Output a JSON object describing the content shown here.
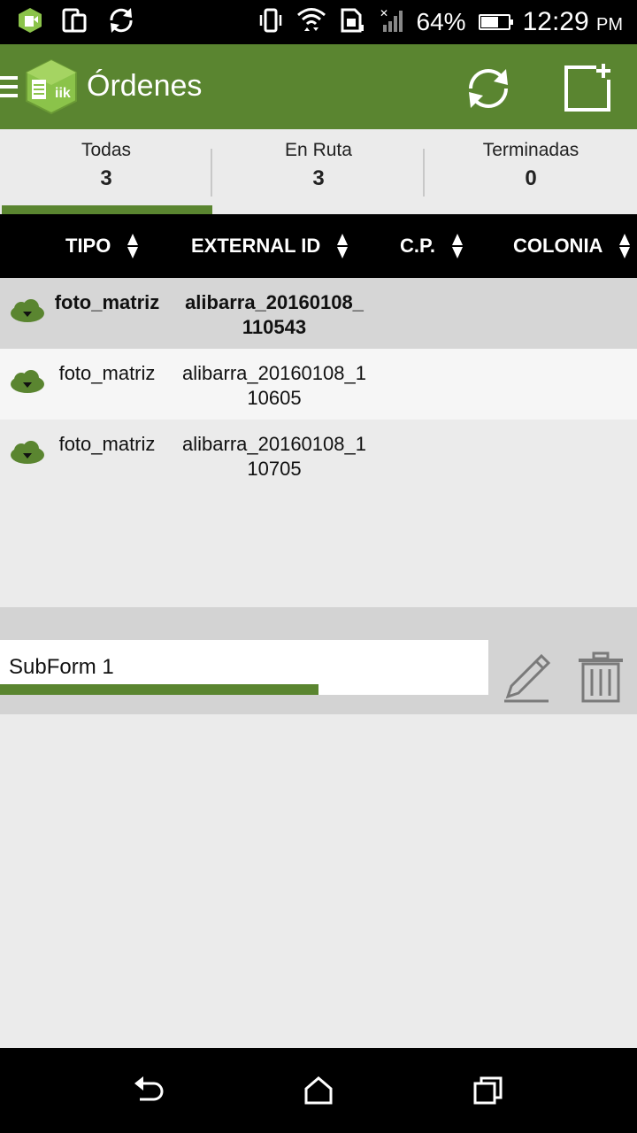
{
  "status_bar": {
    "battery_percent": "64%",
    "battery_level": 0.64,
    "time": "12:29",
    "ampm": "PM",
    "icons": [
      "app-notification-icon",
      "device-rotate-icon",
      "sync-icon",
      "vibrate-icon",
      "wifi-icon",
      "sim-icon",
      "no-signal-icon",
      "battery-icon"
    ]
  },
  "app_bar": {
    "title": "Órdenes",
    "icons": [
      "menu-icon",
      "app-logo",
      "refresh-icon",
      "new-document-icon"
    ]
  },
  "tabs": [
    {
      "label": "Todas",
      "count": "3",
      "selected": true
    },
    {
      "label": "En Ruta",
      "count": "3",
      "selected": false
    },
    {
      "label": "Terminadas",
      "count": "0",
      "selected": false
    }
  ],
  "table": {
    "columns": [
      "TIPO",
      "EXTERNAL ID",
      "C.P.",
      "COLONIA"
    ],
    "rows": [
      {
        "tipo": "foto_matriz",
        "external_id": "alibarra_20160108_110543",
        "cp": "",
        "colonia": "",
        "selected": true
      },
      {
        "tipo": "foto_matriz",
        "external_id": "alibarra_20160108_110605",
        "cp": "",
        "colonia": "",
        "selected": false
      },
      {
        "tipo": "foto_matriz",
        "external_id": "alibarra_20160108_110705",
        "cp": "",
        "colonia": "",
        "selected": false
      }
    ]
  },
  "subform": {
    "value": "SubForm 1",
    "progress": 0.5
  },
  "nav_bar": {
    "icons": [
      "back-icon",
      "home-icon",
      "recents-icon"
    ]
  },
  "colors": {
    "accent": "#5a8530",
    "header_bg": "#000000",
    "selected_row": "#d6d6d6"
  }
}
